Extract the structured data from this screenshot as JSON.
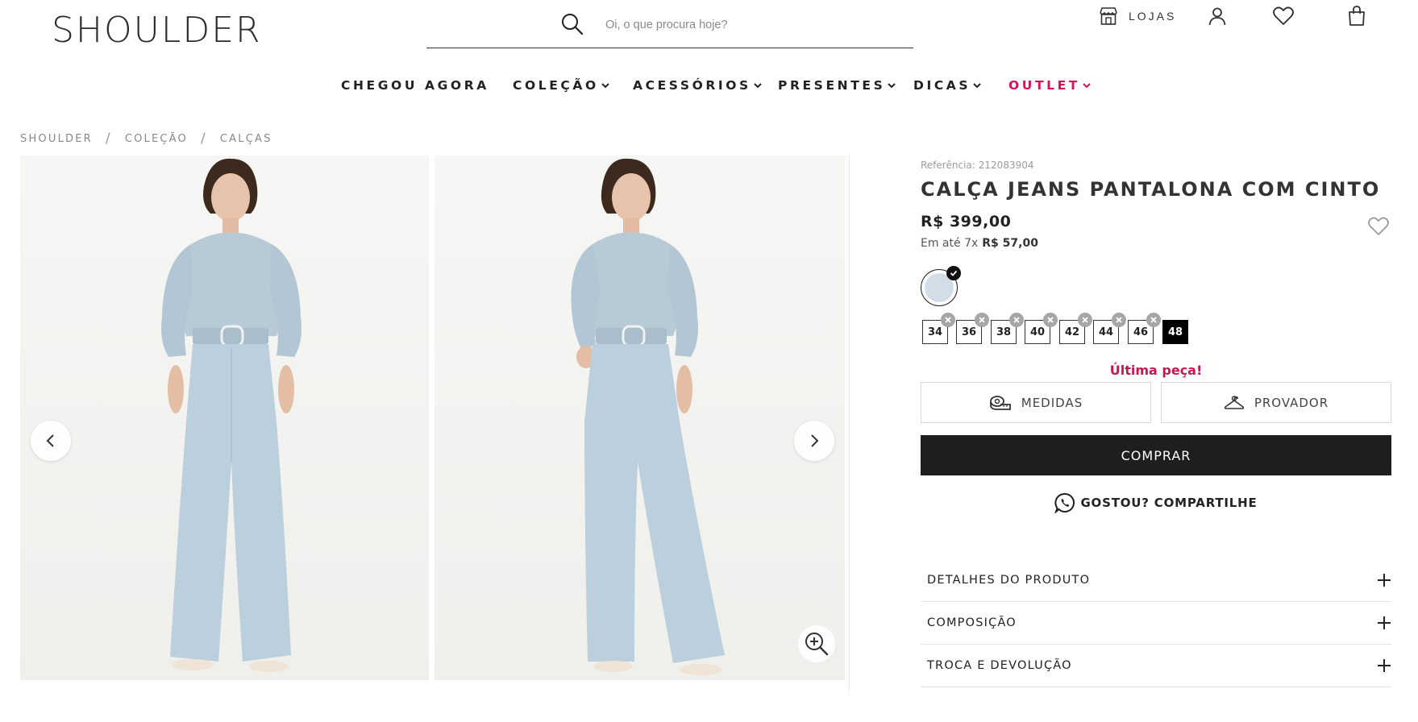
{
  "header": {
    "logo": "SHOULDER",
    "search_placeholder": "Oi, o que procura hoje?",
    "stores_label": "LOJAS"
  },
  "nav": {
    "items": [
      {
        "label": "CHEGOU AGORA",
        "dropdown": false
      },
      {
        "label": "COLEÇÃO",
        "dropdown": true
      },
      {
        "label": "ACESSÓRIOS",
        "dropdown": true
      },
      {
        "label": "PRESENTES",
        "dropdown": true
      },
      {
        "label": "DICAS",
        "dropdown": true
      },
      {
        "label": "OUTLET",
        "dropdown": true
      }
    ]
  },
  "breadcrumb": [
    "SHOULDER",
    "COLEÇÃO",
    "CALÇAS"
  ],
  "product": {
    "reference_label": "Referência:",
    "reference": "212083904",
    "title": "CALÇA JEANS PANTALONA COM CINTO",
    "price": "R$ 399,00",
    "installments_prefix": "Em até 7x",
    "installments_value": "R$ 57,00",
    "color_swatch": "#d3dde7",
    "sizes": [
      {
        "label": "34",
        "available": false
      },
      {
        "label": "36",
        "available": false
      },
      {
        "label": "38",
        "available": false
      },
      {
        "label": "40",
        "available": false
      },
      {
        "label": "42",
        "available": false
      },
      {
        "label": "44",
        "available": false
      },
      {
        "label": "46",
        "available": false
      },
      {
        "label": "48",
        "available": true,
        "selected": true
      }
    ],
    "stock_message": "Última peça!",
    "measures_label": "MEDIDAS",
    "fitting_label": "PROVADOR",
    "buy_label": "COMPRAR",
    "share_label": "GOSTOU? COMPARTILHE"
  },
  "accordion": [
    {
      "label": "DETALHES DO PRODUTO"
    },
    {
      "label": "COMPOSIÇÃO"
    },
    {
      "label": "TROCA E DEVOLUÇÃO"
    }
  ],
  "colors": {
    "accent_outlet": "#d4145a",
    "stock_alert": "#c8174f",
    "buy_button": "#1e1e1e"
  }
}
